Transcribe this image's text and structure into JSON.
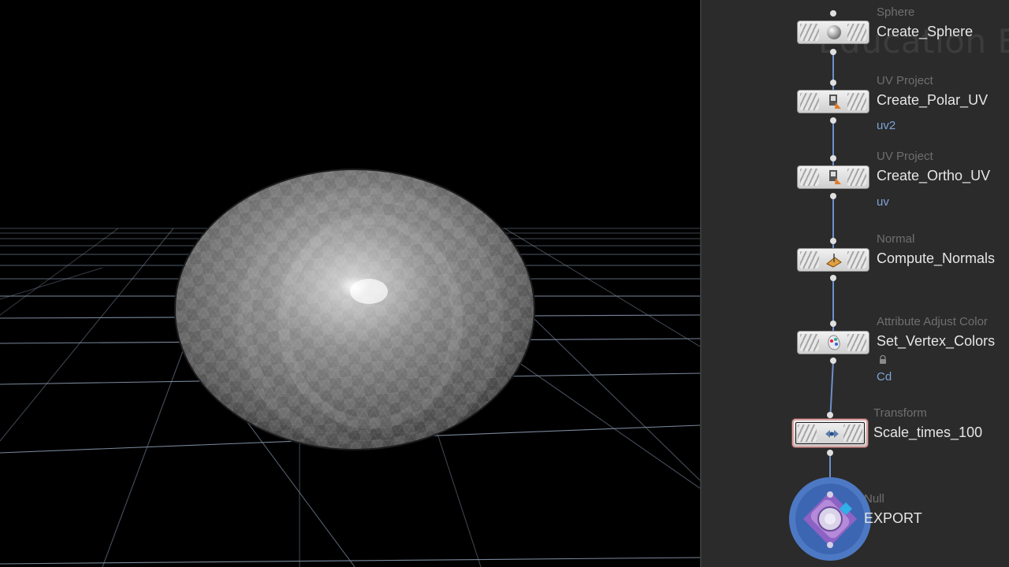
{
  "viewport": {
    "object": "sphere",
    "background": "#000000",
    "grid_color": "#8e9fb5"
  },
  "network": {
    "background": "#2b2b2b",
    "watermark": "Education Edi",
    "wire_color": "#6e8fc9",
    "nodes": [
      {
        "type": "Sphere",
        "name": "Create_Sphere",
        "icon": "sphere-icon",
        "output_attr": ""
      },
      {
        "type": "UV Project",
        "name": "Create_Polar_UV",
        "icon": "uv-project-icon",
        "output_attr": "uv2"
      },
      {
        "type": "UV Project",
        "name": "Create_Ortho_UV",
        "icon": "uv-project-icon",
        "output_attr": "uv"
      },
      {
        "type": "Normal",
        "name": "Compute_Normals",
        "icon": "normal-icon",
        "output_attr": ""
      },
      {
        "type": "Attribute Adjust Color",
        "name": "Set_Vertex_Colors",
        "icon": "color-adjust-icon",
        "output_attr": "Cd",
        "locked": true
      },
      {
        "type": "Transform",
        "name": "Scale_times_100",
        "icon": "transform-icon",
        "output_attr": "",
        "selected": true
      },
      {
        "type": "Null",
        "name": "EXPORT",
        "icon": "null-icon",
        "output_attr": "",
        "display_flag": true
      }
    ]
  }
}
